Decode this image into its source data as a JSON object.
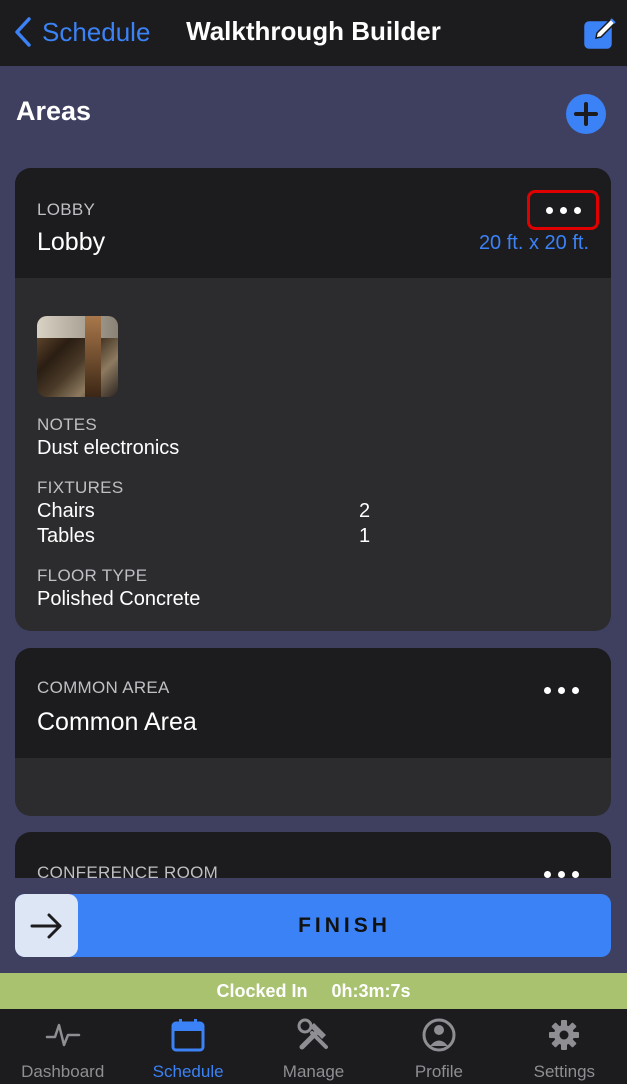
{
  "nav": {
    "back_label": "Schedule",
    "title": "Walkthrough Builder",
    "back_icon": "chevron-left-icon",
    "edit_icon": "edit-icon"
  },
  "areas": {
    "title": "Areas",
    "add_icon": "plus-circle-icon"
  },
  "cards": [
    {
      "category": "LOBBY",
      "name": "Lobby",
      "dimensions": "20 ft. x 20 ft.",
      "notes_label": "NOTES",
      "notes": "Dust electronics",
      "fixtures_label": "FIXTURES",
      "fixtures": [
        {
          "name": "Chairs",
          "qty": "2"
        },
        {
          "name": "Tables",
          "qty": "1"
        }
      ],
      "floor_label": "FLOOR TYPE",
      "floor": "Polished Concrete"
    },
    {
      "category": "COMMON AREA",
      "name": "Common Area"
    },
    {
      "category": "CONFERENCE ROOM"
    }
  ],
  "finish": {
    "label": "FINISH",
    "icon": "arrow-right-icon"
  },
  "clock": {
    "status": "Clocked In",
    "elapsed": "0h:3m:7s"
  },
  "tabs": [
    {
      "label": "Dashboard",
      "icon": "activity-icon",
      "active": false
    },
    {
      "label": "Schedule",
      "icon": "calendar-icon",
      "active": true
    },
    {
      "label": "Manage",
      "icon": "tools-icon",
      "active": false
    },
    {
      "label": "Profile",
      "icon": "user-icon",
      "active": false
    },
    {
      "label": "Settings",
      "icon": "gear-icon",
      "active": false
    }
  ],
  "colors": {
    "accent": "#3b82f6",
    "background": "#3f405f",
    "card": "#2c2c2e",
    "card_header": "#1c1c1e",
    "clock_bar": "#a8c26f",
    "highlight": "#e00000"
  }
}
